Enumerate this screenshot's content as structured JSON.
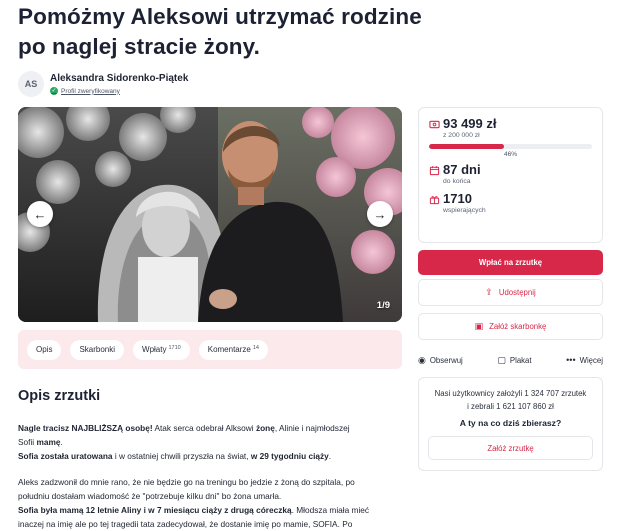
{
  "title_line1": "Pomóżmy Aleksowi utrzymać rodzine",
  "title_line2": "po naglej stracie żony.",
  "author": {
    "initials": "AS",
    "name": "Aleksandra Sidorenko-Piątek",
    "verified_label": "Profil zweryfikowany"
  },
  "gallery": {
    "counter": "1/9",
    "prev_icon": "chevron-left-icon",
    "next_icon": "chevron-right-icon"
  },
  "tabs": [
    {
      "label": "Opis",
      "count": ""
    },
    {
      "label": "Skarbonki",
      "count": ""
    },
    {
      "label": "Wpłaty",
      "count": "1710"
    },
    {
      "label": "Komentarze",
      "count": "14"
    }
  ],
  "description": {
    "heading": "Opis zrzutki",
    "p1_a": "Nagle tracisz NAJBLIŻSZĄ osobę!",
    "p1_b": " Atak serca odebrał Alksowi ",
    "p1_c": "żonę",
    "p1_d": ", Alinie i najmłodszej",
    "p2_a": "Sofii ",
    "p2_b": "mamę",
    "p2_c": ".",
    "p3_a": "Sofia została uratowana",
    "p3_b": " i w ostatniej chwili przyszła na świat, ",
    "p3_c": "w 29 tygodniu ciąży",
    "p3_d": ".",
    "p4": "Aleks zadzwonił do mnie rano, że nie będzie go na treningu bo jedzie z żoną do szpitala, po",
    "p5": "południu dostałam wiadomość że \"potrzebuje kilku dni\" bo żona umarła.",
    "p6_a": "Sofia była mamą 12 letnie Aliny i w 7 miesiącu ciąży z drugą córeczką",
    "p6_b": ". Młodsza miała mieć",
    "p7": "inaczej na imię ale po tej tragedii tata zadecydował, że dostanie imię po mamie, SOFIA. Po"
  },
  "stats": {
    "raised": "93 499 zł",
    "goal": "z 200 000 zł",
    "progress_percent": 46,
    "progress_label": "46%",
    "days": "87 dni",
    "days_sub": "do końca",
    "supporters": "1710",
    "supporters_sub": "wspierających"
  },
  "buttons": {
    "donate": "Wpłać na zrzutkę",
    "share": "Udostępnij",
    "piggy": "Załóż skarbonkę"
  },
  "actions": {
    "watch": "Obserwuj",
    "poster": "Plakat",
    "more": "Więcej"
  },
  "promo": {
    "line1": "Nasi użytkownicy założyli 1 324 707 zrzutek",
    "line2": "i zebrali 1 621 107 860 zł",
    "question": "A ty na co dziś zbierasz?",
    "cta": "Załóż zrzutkę"
  },
  "colors": {
    "accent": "#d7284a",
    "tabs_bg": "#fbe9ec",
    "verified": "#2aa564"
  }
}
